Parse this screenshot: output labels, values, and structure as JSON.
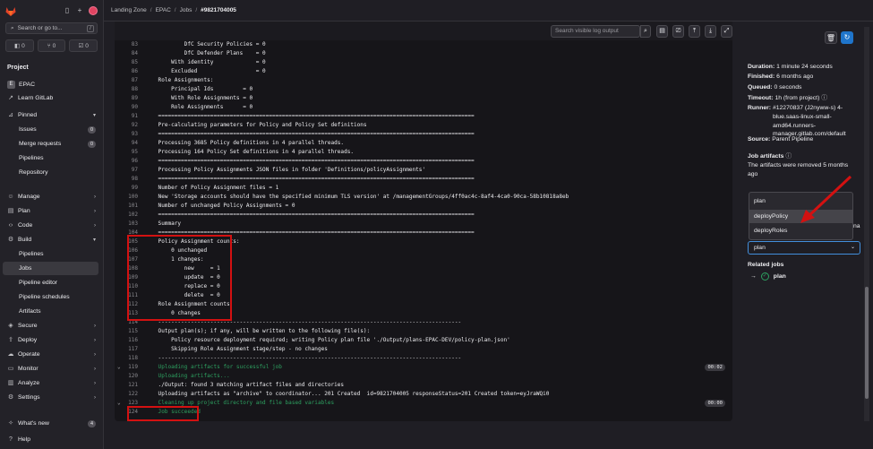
{
  "sidebar": {
    "search_placeholder": "Search or go to...",
    "search_kbd": "/",
    "counters": [
      "0",
      "0",
      "0"
    ],
    "project_heading": "Project",
    "project_avatar": "E",
    "project_name": "EPAC",
    "learn": "Learn GitLab",
    "pinned": "Pinned",
    "issues": "Issues",
    "issues_count": "0",
    "merge_requests": "Merge requests",
    "merge_requests_count": "0",
    "pipelines_pinned": "Pipelines",
    "repository": "Repository",
    "manage": "Manage",
    "plan": "Plan",
    "code": "Code",
    "build": "Build",
    "pipelines": "Pipelines",
    "jobs": "Jobs",
    "pipeline_editor": "Pipeline editor",
    "pipeline_schedules": "Pipeline schedules",
    "artifacts": "Artifacts",
    "secure": "Secure",
    "deploy": "Deploy",
    "operate": "Operate",
    "monitor": "Monitor",
    "analyze": "Analyze",
    "settings": "Settings",
    "whats_new": "What's new",
    "whats_new_count": "4",
    "help": "Help"
  },
  "breadcrumb": [
    "Landing Zone",
    "EPAC",
    "Jobs",
    "#9821704005"
  ],
  "log": {
    "search_placeholder": "Search visible log output",
    "lines": [
      {
        "n": "83",
        "t": "            DfC Security Policies = 0"
      },
      {
        "n": "84",
        "t": "            DfC Defender Plans    = 0"
      },
      {
        "n": "85",
        "t": "        With identity             = 0"
      },
      {
        "n": "86",
        "t": "        Excluded                  = 0"
      },
      {
        "n": "87",
        "t": "    Role Assignments:"
      },
      {
        "n": "88",
        "t": "        Principal Ids         = 0"
      },
      {
        "n": "89",
        "t": "        With Role Assignments = 0"
      },
      {
        "n": "90",
        "t": "        Role Assignments      = 0"
      },
      {
        "n": "91",
        "t": "    ================================================================================================="
      },
      {
        "n": "92",
        "t": "    Pre-calculating parameters for Policy and Policy Set definitions"
      },
      {
        "n": "93",
        "t": "    ================================================================================================="
      },
      {
        "n": "94",
        "t": "    Processing 3685 Policy definitions in 4 parallel threads."
      },
      {
        "n": "95",
        "t": "    Processing 164 Policy Set definitions in 4 parallel threads."
      },
      {
        "n": "96",
        "t": "    ================================================================================================="
      },
      {
        "n": "97",
        "t": "    Processing Policy Assignments JSON files in folder 'Definitions/policyAssignments'"
      },
      {
        "n": "98",
        "t": "    ================================================================================================="
      },
      {
        "n": "99",
        "t": "    Number of Policy Assignment files = 1"
      },
      {
        "n": "100",
        "t": "    New 'Storage accounts should have the specified minimum TLS version' at /managementGroups/4ff0ac4c-8af4-4ca0-90ca-58b10818a8eb"
      },
      {
        "n": "101",
        "t": "    Number of unchanged Policy Assignments = 0"
      },
      {
        "n": "102",
        "t": "    ================================================================================================="
      },
      {
        "n": "103",
        "t": "    Summary"
      },
      {
        "n": "104",
        "t": "    ================================================================================================="
      },
      {
        "n": "105",
        "t": "    Policy Assignment counts:"
      },
      {
        "n": "106",
        "t": "        0 unchanged"
      },
      {
        "n": "107",
        "t": "        1 changes:"
      },
      {
        "n": "108",
        "t": "            new     = 1"
      },
      {
        "n": "109",
        "t": "            update  = 0"
      },
      {
        "n": "110",
        "t": "            replace = 0"
      },
      {
        "n": "111",
        "t": "            delete  = 0"
      },
      {
        "n": "112",
        "t": "    Role Assignment counts:"
      },
      {
        "n": "113",
        "t": "        0 changes"
      },
      {
        "n": "114",
        "t": "    ---------------------------------------------------------------------------------------------"
      },
      {
        "n": "115",
        "t": "    Output plan(s); if any, will be written to the following file(s):"
      },
      {
        "n": "116",
        "t": "        Policy resource deployment required; writing Policy plan file './Output/plans-EPAC-DEV/policy-plan.json'"
      },
      {
        "n": "117",
        "t": "        Skipping Role Assignment stage/step - no changes"
      },
      {
        "n": "118",
        "t": "    ---------------------------------------------------------------------------------------------"
      },
      {
        "n": "119",
        "t": "    Uploading artifacts for successful job",
        "green": true,
        "fold": true,
        "dur": "00:02"
      },
      {
        "n": "120",
        "t": "    Uploading artifacts...",
        "green": true
      },
      {
        "n": "121",
        "t": "    ./Output: found 3 matching artifact files and directories"
      },
      {
        "n": "122",
        "t": "    Uploading artifacts as \"archive\" to coordinator... 201 Created  id=9821704005 responseStatus=201 Created token=eyJraWQi0"
      },
      {
        "n": "123",
        "t": "    Cleaning up project directory and file based variables",
        "green": true,
        "fold": true,
        "dur": "00:00"
      },
      {
        "n": "124",
        "t": "    Job succeeded",
        "green": true
      }
    ]
  },
  "job": {
    "duration_label": "Duration:",
    "duration": "1 minute 24 seconds",
    "finished_label": "Finished:",
    "finished": "6 months ago",
    "queued_label": "Queued:",
    "queued": "0 seconds",
    "timeout_label": "Timeout:",
    "timeout": "1h (from project)",
    "runner_label": "Runner:",
    "runner_1": "#12270837 (J2nyww-s) 4-",
    "runner_2": "blue.saas-linux-small-",
    "runner_3": "amd64.runners-",
    "runner_4": "manager.gitlab.com/default",
    "source_label": "Source:",
    "source": "Parent Pipeline",
    "artifacts_heading": "Job artifacts",
    "artifacts_1": "The artifacts were removed 5 months",
    "artifacts_2": "ago",
    "dropdown_items": [
      "plan",
      "deployPolicy",
      "deployRoles"
    ],
    "dropdown_selected": "plan",
    "hidden_fragment": "na",
    "related_heading": "Related jobs",
    "related_job": "plan"
  },
  "colors": {
    "annotation_red": "#d31111",
    "success_green": "#2da160",
    "focus_blue": "#428fdc"
  }
}
